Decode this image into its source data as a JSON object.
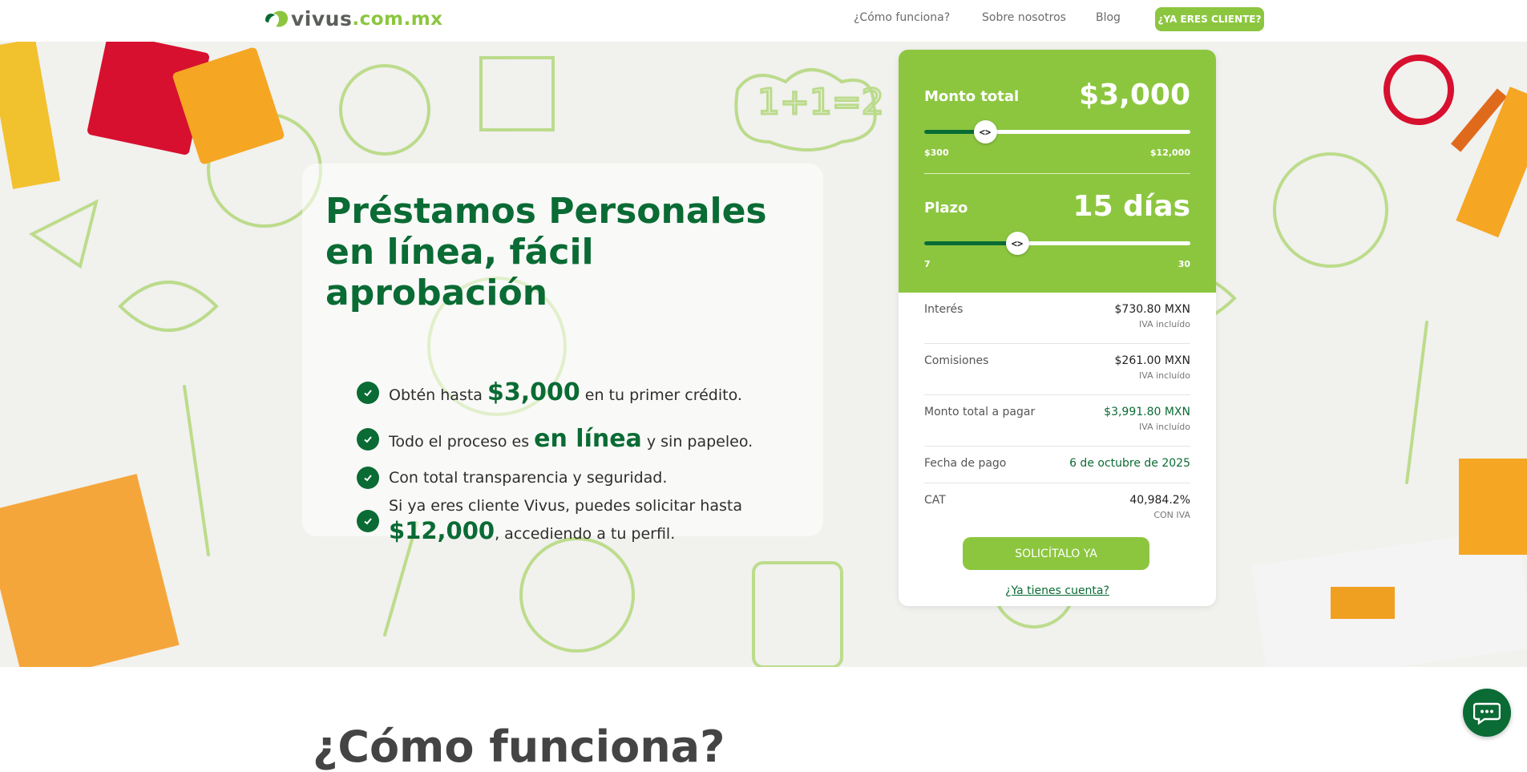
{
  "header": {
    "logo_name": "vivus",
    "logo_tld": ".com.mx",
    "nav": [
      {
        "label": "¿Cómo funciona?"
      },
      {
        "label": "Sobre nosotros"
      },
      {
        "label": "Blog"
      }
    ],
    "cta_label": "¿YA ERES CLIENTE?"
  },
  "hero": {
    "title_line1": "Préstamos Personales",
    "title_line2": "en línea, fácil",
    "title_line3": "aprobación",
    "benefits": {
      "b1_pre": "Obtén hasta ",
      "b1_hl": "$3,000",
      "b1_post": " en tu primer crédito.",
      "b2_pre": "Todo el proceso es ",
      "b2_hl": "en línea",
      "b2_post": " y sin papeleo.",
      "b3": "Con total transparencia y seguridad.",
      "b4_line1": "Si ya eres cliente Vivus, puedes solicitar hasta",
      "b4_hl": "$12,000",
      "b4_post": ", accediendo a tu perfil."
    }
  },
  "calculator": {
    "amount": {
      "label": "Monto total",
      "value": "$3,000",
      "min": "$300",
      "max": "$12,000",
      "position_fraction": 0.23
    },
    "term": {
      "label": "Plazo",
      "value": "15 días",
      "min": "7",
      "max": "30",
      "position_fraction": 0.35
    },
    "knob_glyph": "<>",
    "rows": [
      {
        "label": "Interés",
        "value": "$730.80 MXN",
        "note": "IVA incluído"
      },
      {
        "label": "Comisiones",
        "value": "$261.00 MXN",
        "note": "IVA incluído"
      },
      {
        "label": "Monto total a pagar",
        "value": "$3,991.80 MXN",
        "note": "IVA incluído"
      },
      {
        "label": "Fecha de pago",
        "value": "6 de octubre de 2025",
        "note": ""
      },
      {
        "label": "CAT",
        "value": "40,984.2%",
        "note": "CON IVA"
      }
    ],
    "submit_label": "SOLICÍTALO YA",
    "account_link": "¿Ya tienes cuenta?"
  },
  "section": {
    "title": "¿Cómo funciona?"
  },
  "colors": {
    "brand_green": "#8cc63f",
    "dark_green": "#0a6b34"
  },
  "icons": {
    "check": "check-icon",
    "chat": "chat-icon",
    "logo": "leaf-logo-icon"
  }
}
